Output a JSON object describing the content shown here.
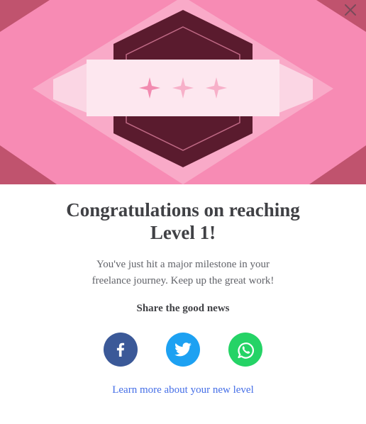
{
  "banner": {
    "colors": {
      "background": "#f78bb4",
      "dark_corners": "#c0536e",
      "ribbon": "#fde7ef",
      "badge": "#5a1b2e",
      "diamonds": "#f28bb0"
    }
  },
  "close_button": {
    "icon": "close-icon"
  },
  "content": {
    "title": "Congratulations on reaching Level 1!",
    "subtitle": "You've just hit a major milestone in your freelance journey. Keep up the great work!",
    "share_heading": "Share the good news",
    "share_buttons": [
      {
        "network": "Facebook",
        "icon": "facebook-icon",
        "color": "#3b5998"
      },
      {
        "network": "Twitter",
        "icon": "twitter-icon",
        "color": "#1da1f2"
      },
      {
        "network": "WhatsApp",
        "icon": "whatsapp-icon",
        "color": "#25d366"
      }
    ],
    "learn_more_link": "Learn more about your new level"
  }
}
